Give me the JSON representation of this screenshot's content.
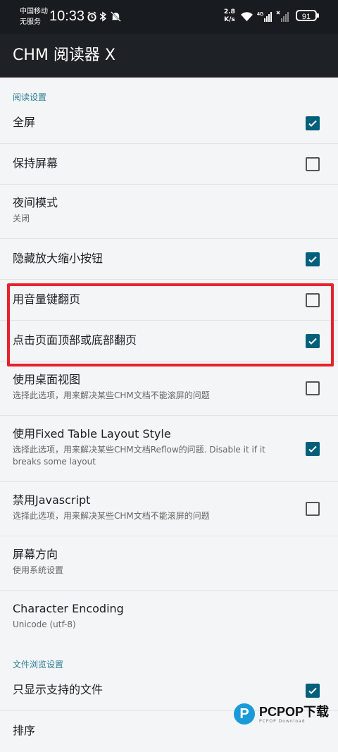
{
  "status_bar": {
    "carrier_line1": "中国移动",
    "carrier_line2": "无服务",
    "time": "10:33",
    "speed_value": "2.8",
    "speed_unit": "K/s",
    "network": "4G",
    "battery": "91",
    "icons": [
      "alarm-icon",
      "bluetooth-icon",
      "mute-icon",
      "wifi-icon",
      "signal-icon"
    ]
  },
  "app_bar": {
    "title": "CHM 阅读器 X"
  },
  "sections": [
    {
      "title": "阅读设置",
      "items": [
        {
          "title": "全屏",
          "checked": true
        },
        {
          "title": "保持屏幕",
          "checked": false
        },
        {
          "title": "夜间模式",
          "subtitle": "关闭"
        },
        {
          "title": "隐藏放大缩小按钮",
          "checked": true
        },
        {
          "title": "用音量键翻页",
          "checked": false
        },
        {
          "title": "点击页面顶部或底部翻页",
          "checked": true
        },
        {
          "title": "使用桌面视图",
          "subtitle": "选择此选项，用来解决某些CHM文档不能滚屏的问题",
          "checked": false
        },
        {
          "title": "使用Fixed Table Layout Style",
          "subtitle": "选择此选项，用来解决某些CHM文档Reflow的问题. Disable it if it breaks some layout",
          "checked": true
        },
        {
          "title": "禁用Javascript",
          "subtitle": "选择此选项，用来解决某些CHM文档不能滚屏的问题",
          "checked": false
        },
        {
          "title": "屏幕方向",
          "subtitle": "使用系统设置"
        },
        {
          "title": "Character Encoding",
          "subtitle": "Unicode (utf-8)"
        }
      ]
    },
    {
      "title": "文件浏览设置",
      "items": [
        {
          "title": "只显示支持的文件",
          "checked": true
        },
        {
          "title": "排序"
        }
      ]
    }
  ],
  "watermark": {
    "mark": "P",
    "text": "PCPOP下载",
    "sub": "PCPOP Download"
  },
  "colors": {
    "accent": "#005f7a",
    "section_header": "#2a7f94",
    "highlight": "#e6222c",
    "app_bar": "#1e2226"
  }
}
